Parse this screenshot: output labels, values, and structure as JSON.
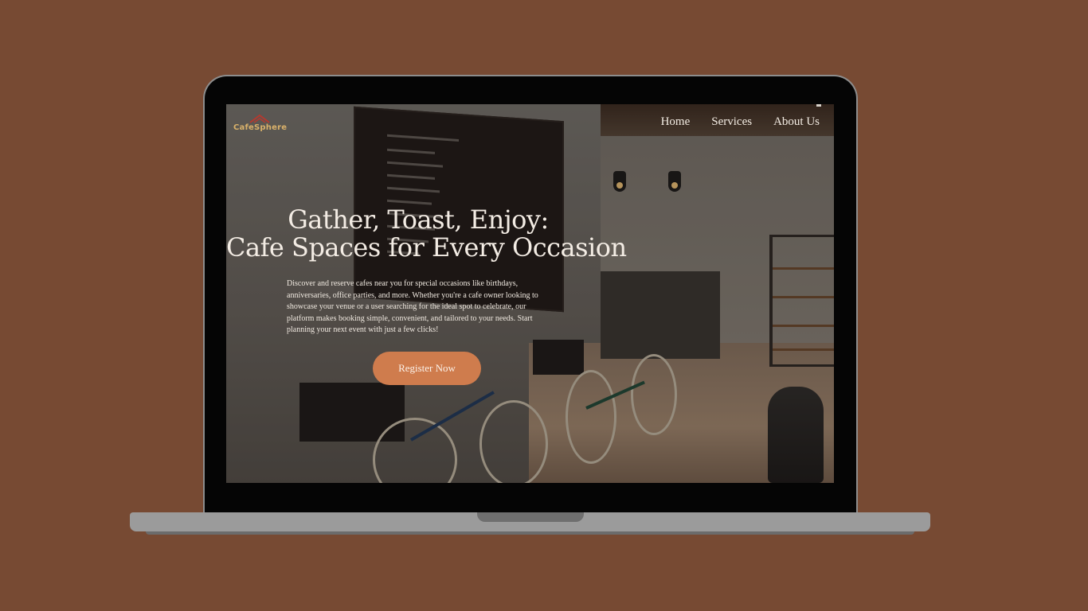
{
  "site": {
    "logo_text": "CafeSphere",
    "nav": [
      {
        "label": "Home"
      },
      {
        "label": "Services"
      },
      {
        "label": "About Us"
      }
    ]
  },
  "hero": {
    "title_line1": "Gather, Toast, Enjoy:",
    "title_line2": "Cafe Spaces for Every Occasion",
    "description": "Discover and reserve cafes near you for special occasions like birthdays, anniversaries, office parties, and more. Whether you're a cafe owner looking to showcase your venue or a user searching for the ideal spot to celebrate, our platform makes booking simple, convenient, and tailored to your needs. Start planning your next event with just a few clicks!",
    "cta_label": "Register Now"
  },
  "colors": {
    "background": "#774a33",
    "accent": "#cf7c4d",
    "logo": "#d9b16a",
    "text": "#f3ece4"
  }
}
